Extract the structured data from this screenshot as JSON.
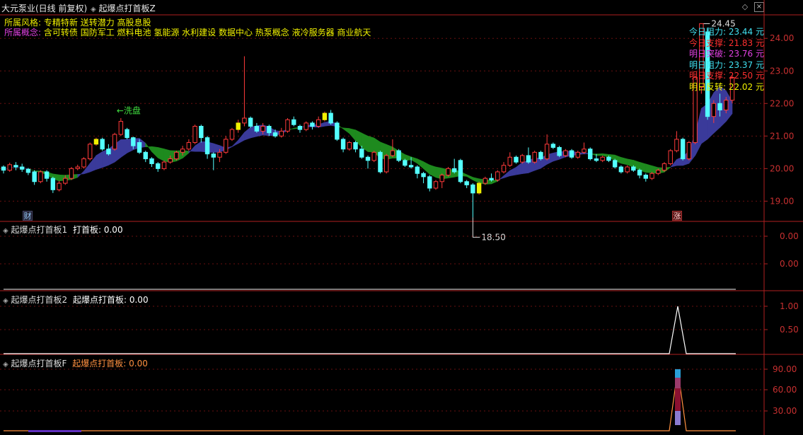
{
  "header": {
    "stock_title": "大元泵业(日线 前复权)",
    "indicator_title": "起爆点打首板Z",
    "style_label": "所属风格:",
    "style_value": "专精特新 送转潜力 高股息股",
    "concept_label": "所属概念:",
    "concept_value": "含可转债 国防军工 燃料电池 氢能源 水利建设 数据中心 热泵概念 液冷服务器 商业航天"
  },
  "main_chart": {
    "y_ticks": [
      "24.00",
      "23.00",
      "22.00",
      "21.00",
      "20.00",
      "19.00"
    ],
    "high_label": "24.45",
    "low_label": "18.50",
    "annotation": "←洗盘",
    "badge_left": "财",
    "badge_right": "涨",
    "legend": [
      {
        "text": "今日阻力: 23.44 元",
        "color": "#40e0f0"
      },
      {
        "text": "今日支撑: 21.83 元",
        "color": "#ff3030"
      },
      {
        "text": "明日突破: 23.76 元",
        "color": "#e040e0"
      },
      {
        "text": "明日阻力: 23.37 元",
        "color": "#40e0f0"
      },
      {
        "text": "明日支撑: 22.50 元",
        "color": "#ff3030"
      },
      {
        "text": "明日反转: 22.02 元",
        "color": "#f0f000"
      }
    ],
    "colors": {
      "up": "#ff3a3a",
      "down": "#54ffff",
      "ribbon_up": "#3a3a9a",
      "ribbon_down": "#1e8a1e",
      "signal": "#f0f000"
    }
  },
  "panels": [
    {
      "title": "起爆点打首板1",
      "sub": "打首板: 0.00",
      "sub_color": "#ffffff",
      "y_ticks": [
        "0.00",
        "0.00"
      ]
    },
    {
      "title": "起爆点打首板2",
      "sub": "起爆点打首板: 0.00",
      "sub_color": "#ffffff",
      "y_ticks": [
        "1.00",
        "0.50"
      ]
    },
    {
      "title": "起爆点打首板F",
      "sub": "起爆点打首板: 0.00",
      "sub_color": "#ff9040",
      "y_ticks": [
        "90.00",
        "60.00",
        "30.00"
      ]
    }
  ],
  "chart_data": {
    "type": "candlestick",
    "y_range": [
      18.4,
      24.7
    ],
    "candles": [
      [
        20.05,
        19.95,
        20.1,
        19.85
      ],
      [
        19.95,
        20.12,
        20.18,
        19.9
      ],
      [
        20.1,
        20.05,
        20.2,
        19.95
      ],
      [
        20.05,
        19.98,
        20.15,
        19.9
      ],
      [
        19.98,
        19.88,
        20.02,
        19.8
      ],
      [
        19.9,
        19.6,
        19.95,
        19.5
      ],
      [
        19.6,
        19.9,
        19.95,
        19.55
      ],
      [
        19.9,
        19.7,
        19.95,
        19.6
      ],
      [
        19.7,
        19.35,
        19.75,
        19.25
      ],
      [
        19.35,
        19.55,
        19.62,
        19.3
      ],
      [
        19.55,
        19.7,
        19.8,
        19.5
      ],
      [
        19.7,
        20.0,
        20.05,
        19.65
      ],
      [
        20.0,
        20.05,
        20.12,
        19.95
      ],
      [
        20.05,
        20.3,
        20.35,
        20.0
      ],
      [
        20.3,
        20.75,
        20.8,
        20.25
      ],
      [
        20.75,
        20.9,
        20.95,
        20.7
      ],
      [
        20.9,
        20.6,
        20.95,
        20.55
      ],
      [
        20.6,
        20.45,
        20.75,
        20.4
      ],
      [
        20.6,
        21.05,
        21.1,
        20.55
      ],
      [
        21.05,
        21.45,
        21.55,
        21.0
      ],
      [
        21.2,
        20.95,
        21.25,
        20.9
      ],
      [
        20.95,
        20.7,
        20.98,
        20.6
      ],
      [
        20.8,
        20.5,
        20.9,
        20.45
      ],
      [
        20.5,
        20.3,
        20.55,
        20.2
      ],
      [
        20.3,
        20.15,
        20.35,
        20.05
      ],
      [
        20.15,
        20.0,
        20.2,
        19.9
      ],
      [
        20.0,
        20.2,
        20.25,
        19.95
      ],
      [
        20.2,
        20.3,
        20.4,
        20.15
      ],
      [
        20.3,
        20.5,
        20.55,
        20.25
      ],
      [
        20.5,
        20.6,
        20.7,
        20.4
      ],
      [
        20.6,
        20.8,
        20.9,
        20.55
      ],
      [
        20.8,
        21.3,
        21.35,
        20.75
      ],
      [
        21.3,
        20.95,
        21.35,
        20.8
      ],
      [
        20.95,
        20.45,
        21.0,
        20.3
      ],
      [
        20.45,
        20.35,
        20.5,
        19.95
      ],
      [
        20.35,
        20.5,
        20.6,
        20.2
      ],
      [
        20.5,
        20.9,
        21.0,
        20.45
      ],
      [
        20.9,
        21.2,
        21.25,
        20.85
      ],
      [
        21.2,
        21.4,
        21.5,
        21.1
      ],
      [
        21.4,
        21.55,
        23.45,
        21.3
      ],
      [
        21.55,
        21.3,
        21.6,
        21.25
      ],
      [
        21.3,
        21.15,
        21.4,
        21.1
      ],
      [
        21.15,
        21.3,
        21.4,
        21.05
      ],
      [
        21.3,
        21.1,
        21.35,
        21.0
      ],
      [
        21.1,
        21.0,
        21.2,
        20.95
      ],
      [
        21.0,
        21.15,
        21.25,
        20.95
      ],
      [
        21.15,
        21.5,
        21.55,
        21.1
      ],
      [
        21.5,
        21.35,
        21.6,
        21.3
      ],
      [
        21.3,
        21.2,
        21.35,
        21.1
      ],
      [
        21.2,
        21.4,
        21.45,
        21.15
      ],
      [
        21.4,
        21.3,
        21.45,
        21.2
      ],
      [
        21.3,
        21.5,
        21.6,
        21.25
      ],
      [
        21.5,
        21.7,
        21.75,
        21.45
      ],
      [
        21.7,
        21.4,
        21.8,
        21.35
      ],
      [
        21.4,
        20.9,
        21.45,
        20.85
      ],
      [
        20.9,
        20.6,
        20.95,
        20.5
      ],
      [
        20.6,
        20.8,
        20.85,
        20.55
      ],
      [
        20.8,
        20.6,
        20.85,
        20.5
      ],
      [
        20.6,
        20.35,
        20.7,
        20.3
      ],
      [
        20.35,
        20.25,
        20.4,
        20.0
      ],
      [
        20.25,
        20.5,
        20.55,
        20.2
      ],
      [
        20.5,
        19.9,
        20.55,
        19.85
      ],
      [
        19.9,
        20.4,
        20.45,
        19.85
      ],
      [
        20.4,
        20.55,
        20.9,
        20.35
      ],
      [
        20.55,
        20.25,
        20.6,
        20.2
      ],
      [
        20.25,
        20.1,
        20.3,
        20.05
      ],
      [
        20.1,
        20.05,
        20.35,
        20.0
      ],
      [
        20.05,
        19.85,
        20.1,
        19.7
      ],
      [
        19.85,
        19.75,
        19.9,
        19.55
      ],
      [
        19.75,
        19.4,
        19.8,
        19.3
      ],
      [
        19.4,
        19.6,
        19.65,
        19.35
      ],
      [
        19.6,
        19.8,
        19.85,
        19.4
      ],
      [
        19.8,
        20.0,
        20.05,
        19.75
      ],
      [
        20.0,
        19.9,
        20.3,
        19.85
      ],
      [
        20.25,
        19.6,
        20.3,
        19.55
      ],
      [
        19.6,
        19.5,
        19.65,
        19.4
      ],
      [
        19.5,
        19.25,
        19.55,
        18.5
      ],
      [
        19.25,
        19.55,
        19.6,
        19.2
      ],
      [
        19.55,
        19.7,
        19.75,
        19.5
      ],
      [
        19.7,
        19.65,
        19.85,
        19.6
      ],
      [
        19.65,
        19.9,
        19.95,
        19.6
      ],
      [
        19.9,
        20.1,
        20.2,
        19.85
      ],
      [
        20.1,
        20.35,
        20.5,
        20.05
      ],
      [
        20.35,
        20.2,
        20.4,
        20.15
      ],
      [
        20.2,
        20.4,
        20.45,
        20.15
      ],
      [
        20.4,
        20.2,
        20.65,
        20.15
      ],
      [
        20.2,
        20.5,
        20.55,
        20.15
      ],
      [
        20.5,
        20.3,
        20.55,
        20.25
      ],
      [
        20.3,
        20.75,
        21.05,
        20.25
      ],
      [
        20.75,
        20.65,
        20.8,
        20.6
      ],
      [
        20.65,
        20.4,
        20.7,
        20.35
      ],
      [
        20.4,
        20.55,
        20.6,
        20.35
      ],
      [
        20.55,
        20.35,
        20.6,
        20.3
      ],
      [
        20.35,
        20.5,
        20.55,
        20.3
      ],
      [
        20.5,
        20.6,
        20.8,
        20.45
      ],
      [
        20.6,
        20.3,
        20.65,
        20.25
      ],
      [
        20.3,
        20.25,
        20.45,
        20.2
      ],
      [
        20.25,
        20.35,
        20.4,
        20.2
      ],
      [
        20.35,
        20.25,
        20.4,
        20.2
      ],
      [
        20.25,
        20.05,
        20.3,
        20.0
      ],
      [
        20.05,
        19.9,
        20.1,
        19.85
      ],
      [
        19.9,
        20.05,
        20.1,
        19.85
      ],
      [
        20.05,
        19.95,
        20.1,
        19.9
      ],
      [
        19.95,
        19.8,
        20.0,
        19.7
      ],
      [
        19.8,
        19.7,
        19.85,
        19.6
      ],
      [
        19.7,
        19.85,
        19.9,
        19.65
      ],
      [
        19.85,
        19.95,
        20.0,
        19.8
      ],
      [
        19.95,
        20.15,
        20.2,
        19.9
      ],
      [
        20.15,
        20.55,
        20.6,
        20.1
      ],
      [
        20.55,
        20.9,
        21.15,
        20.5
      ],
      [
        20.9,
        20.3,
        20.95,
        20.25
      ],
      [
        20.3,
        20.8,
        20.85,
        20.25
      ],
      [
        20.8,
        22.8,
        22.85,
        20.75
      ],
      [
        22.5,
        24.45,
        24.45,
        22.3
      ],
      [
        24.2,
        21.6,
        24.3,
        21.5
      ],
      [
        21.6,
        22.0,
        22.1,
        21.4
      ],
      [
        22.0,
        21.8,
        22.3,
        21.6
      ],
      [
        21.8,
        22.1,
        22.2,
        21.7
      ],
      [
        22.1,
        22.8,
        22.85,
        22.0
      ]
    ],
    "signal_candles": [
      15,
      38,
      52,
      77
    ]
  }
}
